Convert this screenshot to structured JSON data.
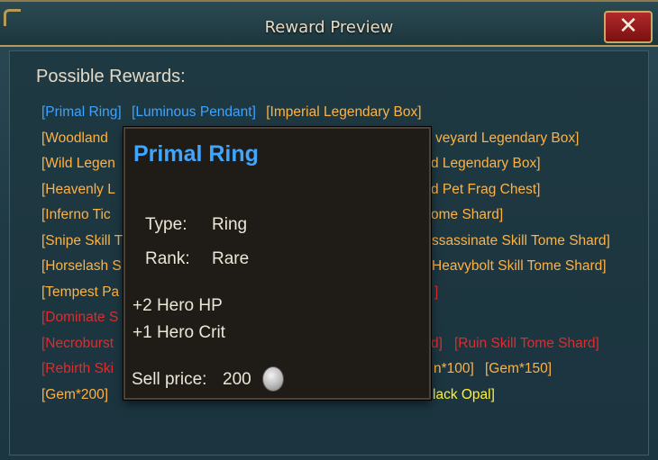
{
  "window": {
    "title": "Reward Preview",
    "close_label": "✕"
  },
  "rewards": {
    "heading": "Possible Rewards:",
    "rows": [
      [
        {
          "label": "[Primal Ring]",
          "color": "blue"
        },
        {
          "label": "[Luminous Pendant]",
          "color": "blue"
        },
        {
          "label": "[Imperial Legendary Box]",
          "color": "orange"
        }
      ],
      [
        {
          "label": "[Woodland",
          "color": "orange"
        },
        {
          "label": "veyard Legendary Box]",
          "color": "orange"
        }
      ],
      [
        {
          "label": "[Wild Legen",
          "color": "orange"
        },
        {
          "label": "d Legendary Box]",
          "color": "orange"
        }
      ],
      [
        {
          "label": "[Heavenly L",
          "color": "orange"
        },
        {
          "label": "d Pet Frag Chest]",
          "color": "orange"
        }
      ],
      [
        {
          "label": "[Inferno Tic",
          "color": "orange"
        },
        {
          "label": "ome Shard]",
          "color": "orange"
        }
      ],
      [
        {
          "label": "[Snipe Skill T",
          "color": "orange"
        },
        {
          "label": "ssassinate Skill Tome Shard]",
          "color": "orange"
        }
      ],
      [
        {
          "label": "[Horselash S",
          "color": "orange"
        },
        {
          "label": "Heavybolt Skill Tome Shard]",
          "color": "orange"
        }
      ],
      [
        {
          "label": "[Tempest Pa",
          "color": "orange"
        },
        {
          "label": "]",
          "color": "red"
        }
      ],
      [
        {
          "label": "[Dominate S",
          "color": "red"
        }
      ],
      [
        {
          "label": "[Necroburst",
          "color": "red"
        },
        {
          "label": "d]",
          "color": "red"
        },
        {
          "label": "[Ruin Skill Tome Shard]",
          "color": "red"
        }
      ],
      [
        {
          "label": "[Rebirth Ski",
          "color": "red"
        },
        {
          "label": "n*100]",
          "color": "orange"
        },
        {
          "label": "[Gem*150]",
          "color": "orange"
        }
      ],
      [
        {
          "label": "[Gem*200]",
          "color": "orange"
        },
        {
          "label": "lack Opal]",
          "color": "yellow"
        }
      ]
    ]
  },
  "tooltip": {
    "name": "Primal Ring",
    "type_label": "Type:",
    "type_value": "Ring",
    "rank_label": "Rank:",
    "rank_value": "Rare",
    "stats": [
      "+2 Hero HP",
      "+1 Hero Crit"
    ],
    "sell_label": "Sell price:",
    "sell_value": "200",
    "currency_icon": "silver-coin-icon"
  },
  "colors": {
    "blue": "#3fa2ff",
    "orange": "#ffb244",
    "red": "#e22b2b",
    "yellow": "#fff23a"
  }
}
